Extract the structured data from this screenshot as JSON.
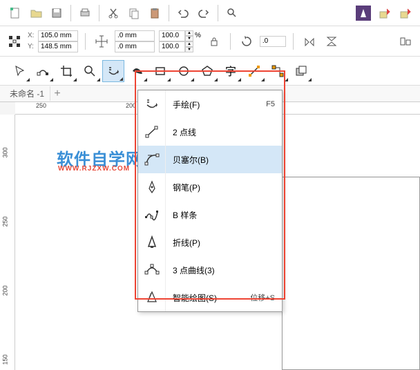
{
  "topToolbar": {
    "icons": [
      "new-doc",
      "open-folder",
      "save",
      "print",
      "cut",
      "copy",
      "paste",
      "undo",
      "redo",
      "search",
      "launch",
      "import",
      "export"
    ]
  },
  "propertyBar": {
    "xLabel": "X:",
    "yLabel": "Y:",
    "xValue": "105.0 mm",
    "yValue": "148.5 mm",
    "wValue": ".0 mm",
    "hValue": ".0 mm",
    "scaleX": "100.0",
    "scaleY": "100.0",
    "rotation": ".0"
  },
  "toolBar": {
    "tools": [
      "pick",
      "shape",
      "crop",
      "zoom",
      "freehand",
      "artistic-media",
      "rectangle",
      "ellipse",
      "polygon",
      "text",
      "dimension",
      "connector",
      "effects"
    ]
  },
  "tab": {
    "name": "未命名 -1",
    "addLabel": "+"
  },
  "ruler": {
    "h": [
      "250",
      "200"
    ],
    "v": [
      "300",
      "250",
      "200",
      "150"
    ]
  },
  "watermark": {
    "main": "软件自学网",
    "sub": "WWW.RJZXW.COM"
  },
  "flyout": {
    "items": [
      {
        "icon": "freehand",
        "label": "手绘(F)",
        "shortcut": "F5"
      },
      {
        "icon": "two-point",
        "label": "2 点线",
        "shortcut": ""
      },
      {
        "icon": "bezier",
        "label": "贝塞尔(B)",
        "shortcut": ""
      },
      {
        "icon": "pen",
        "label": "钢笔(P)",
        "shortcut": ""
      },
      {
        "icon": "bspline",
        "label": "B 样条",
        "shortcut": ""
      },
      {
        "icon": "polyline",
        "label": "折线(P)",
        "shortcut": ""
      },
      {
        "icon": "three-point-curve",
        "label": "3 点曲线(3)",
        "shortcut": ""
      },
      {
        "icon": "smart-draw",
        "label": "智能绘图(S)",
        "shortcut": "位移+S"
      }
    ],
    "selectedIndex": 2
  }
}
